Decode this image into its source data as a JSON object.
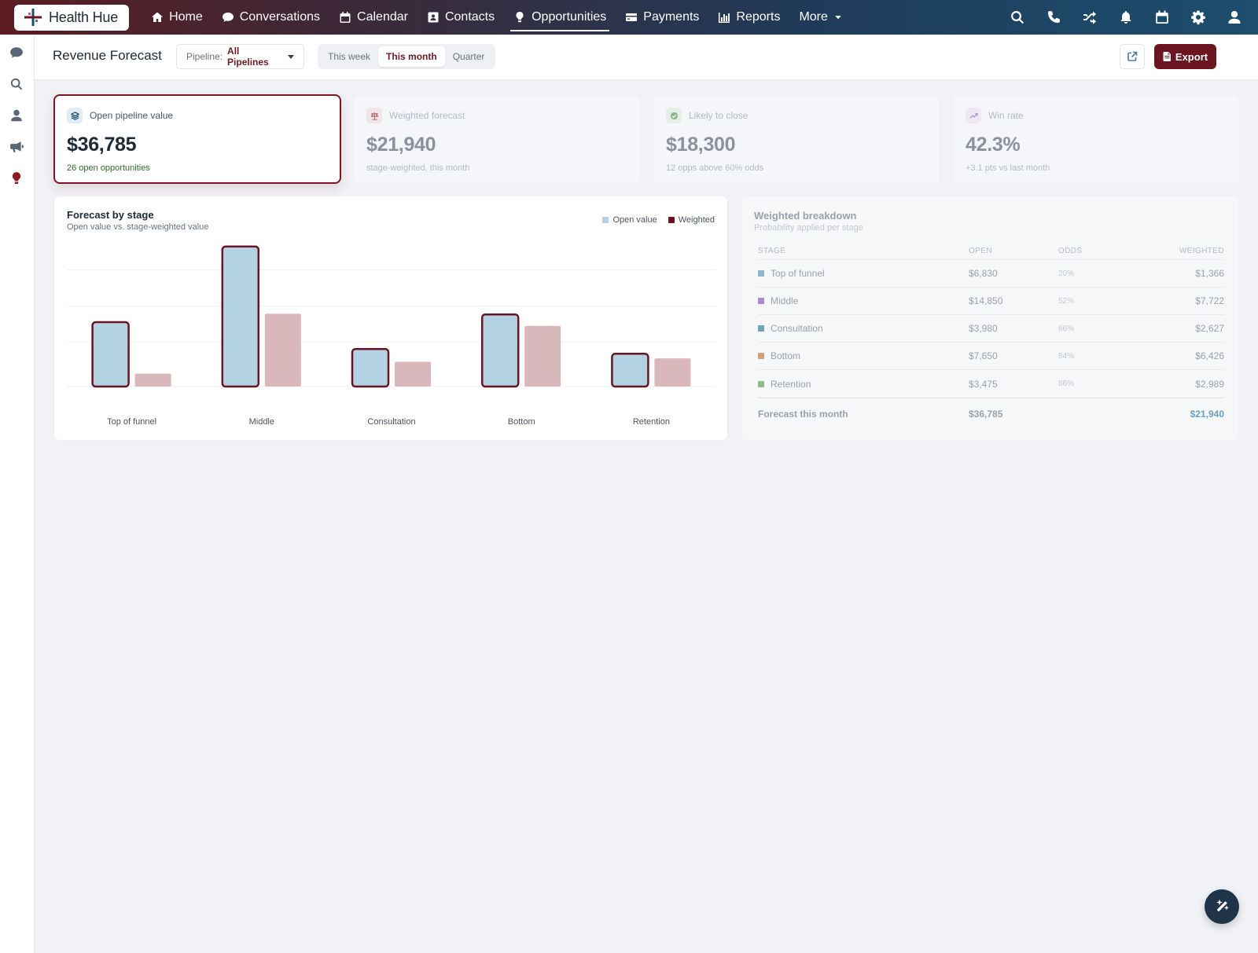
{
  "brand": {
    "name": "Health Hue"
  },
  "nav": {
    "items": [
      {
        "label": "Home",
        "icon": "home-icon"
      },
      {
        "label": "Conversations",
        "icon": "chat-icon"
      },
      {
        "label": "Calendar",
        "icon": "calendar-icon"
      },
      {
        "label": "Contacts",
        "icon": "contact-card-icon"
      },
      {
        "label": "Opportunities",
        "icon": "lightbulb-icon",
        "active": true
      },
      {
        "label": "Payments",
        "icon": "credit-card-icon"
      },
      {
        "label": "Reports",
        "icon": "bar-chart-icon"
      },
      {
        "label": "More",
        "icon": "caret-down-icon"
      }
    ],
    "right_icons": [
      "search-icon",
      "phone-icon",
      "shuffle-icon",
      "bell-icon",
      "calendar-icon",
      "gear-icon",
      "user-icon"
    ]
  },
  "rail": {
    "icons": [
      "chat-icon",
      "search-icon",
      "user-icon",
      "megaphone-icon",
      "lightbulb-icon"
    ]
  },
  "header": {
    "title": "Revenue Forecast",
    "pipeline_label": "Pipeline:",
    "pipeline_value": "All Pipelines",
    "periods": [
      "This week",
      "This month",
      "Quarter"
    ],
    "active_period": "This month",
    "export_label": "Export"
  },
  "kpis": [
    {
      "label": "Open pipeline value",
      "value": "$36,785",
      "sub": "26 open opportunities",
      "icon": "layers-icon",
      "color": "#1d4e6e"
    },
    {
      "label": "Weighted forecast",
      "value": "$21,940",
      "sub": "stage-weighted, this month",
      "icon": "scale-icon",
      "color": "#b06a70"
    },
    {
      "label": "Likely to close",
      "value": "$18,300",
      "sub": "12 opps above 60% odds",
      "icon": "check-circle-icon",
      "color": "#6a9a6a"
    },
    {
      "label": "Win rate",
      "value": "42.3%",
      "sub": "+3.1 pts vs last month",
      "icon": "trend-up-icon",
      "color": "#9a7ac0"
    }
  ],
  "chart_card": {
    "title": "Forecast by stage",
    "subtitle": "Open value vs. stage-weighted value"
  },
  "chart_data": {
    "type": "bar",
    "categories": [
      "Top of funnel",
      "Middle",
      "Consultation",
      "Bottom",
      "Retention"
    ],
    "series": [
      {
        "name": "Open value",
        "values": [
          6830,
          14850,
          3980,
          7650,
          3475
        ],
        "color": "#b3d3e4"
      },
      {
        "name": "Weighted",
        "values": [
          1366,
          7722,
          2627,
          6426,
          2989
        ],
        "color": "#d9b8bc"
      }
    ],
    "legend": [
      {
        "label": "Open value",
        "color": "#b3d3e4"
      },
      {
        "label": "Weighted",
        "color": "#6b1520"
      }
    ],
    "ylim": [
      0,
      15000
    ],
    "grid": true,
    "legend_position": "top-right",
    "highlight_color": "#6b1520"
  },
  "breakdown": {
    "title": "Weighted breakdown",
    "subtitle": "Probability applied per stage",
    "columns": [
      "STAGE",
      "OPEN",
      "ODDS",
      "WEIGHTED"
    ],
    "rows": [
      {
        "stage": "Top of funnel",
        "open": "$6,830",
        "odds": "20%",
        "weighted": "$1,366",
        "color": "#8fb8cc"
      },
      {
        "stage": "Middle",
        "open": "$14,850",
        "odds": "52%",
        "weighted": "$7,722",
        "color": "#a98ad6"
      },
      {
        "stage": "Consultation",
        "open": "$3,980",
        "odds": "66%",
        "weighted": "$2,627",
        "color": "#6aa7b8"
      },
      {
        "stage": "Bottom",
        "open": "$7,650",
        "odds": "84%",
        "weighted": "$6,426",
        "color": "#d4a27a"
      },
      {
        "stage": "Retention",
        "open": "$3,475",
        "odds": "86%",
        "weighted": "$2,989",
        "color": "#93bf87"
      }
    ],
    "total": {
      "label": "Forecast this month",
      "open": "$36,785",
      "weighted": "$21,940"
    }
  }
}
